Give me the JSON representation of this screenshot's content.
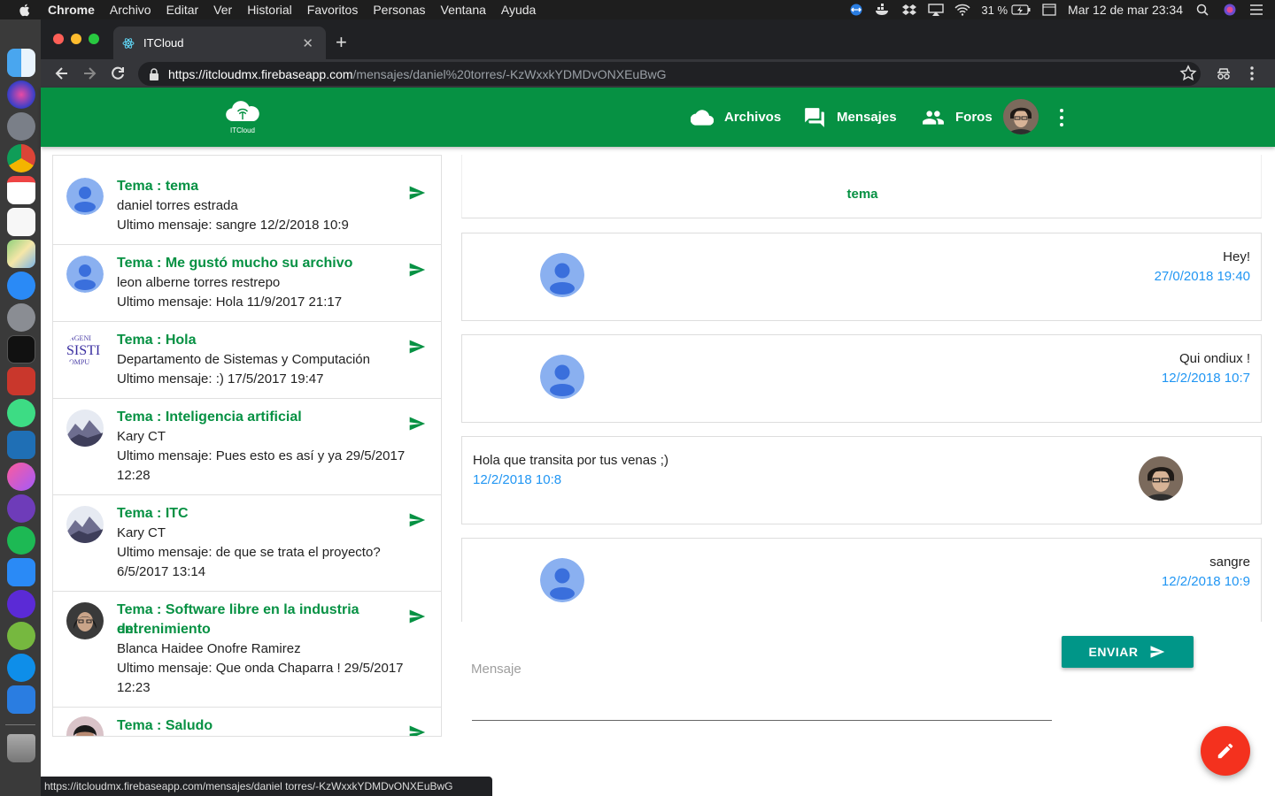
{
  "menubar": {
    "app_name": "Chrome",
    "items": [
      "Archivo",
      "Editar",
      "Ver",
      "Historial",
      "Favoritos",
      "Personas",
      "Ventana",
      "Ayuda"
    ],
    "battery": "31 %",
    "datetime": "Mar 12 de mar  23:34"
  },
  "browser": {
    "tab_title": "ITCloud",
    "url_host": "https://itcloudmx.firebaseapp.com",
    "url_path": "/mensajes/daniel%20torres/-KzWxxkYDMDvONXEuBwG",
    "status_url": "https://itcloudmx.firebaseapp.com/mensajes/daniel torres/-KzWxxkYDMDvONXEuBwG"
  },
  "header": {
    "logo_text": "ITCloud",
    "nav": [
      {
        "label": "Archivos",
        "icon": "cloud-icon"
      },
      {
        "label": "Mensajes",
        "icon": "forum-icon"
      },
      {
        "label": "Foros",
        "icon": "people-icon"
      }
    ]
  },
  "threads": [
    {
      "title": "Tema : tema",
      "author": "daniel torres estrada",
      "last": "Ultimo mensaje: sangre 12/2/2018 10:9",
      "last2": "",
      "avatar": "default"
    },
    {
      "title": "Tema : Me gustó mucho su archivo",
      "author": "leon alberne torres restrepo",
      "last": "Ultimo mensaje: Hola 11/9/2017 21:17",
      "last2": "",
      "avatar": "default"
    },
    {
      "title": "Tema : Hola",
      "author": "Departamento de Sistemas y Computación",
      "last": "Ultimo mensaje: :) 17/5/2017 19:47",
      "last2": "",
      "avatar": "logo"
    },
    {
      "title": "Tema : Inteligencia artificial",
      "author": "Kary CT",
      "last": "Ultimo mensaje: Pues esto es así y ya 29/5/2017",
      "last2": "12:28",
      "avatar": "landscape"
    },
    {
      "title": "Tema : ITC",
      "author": "Kary CT",
      "last": "Ultimo mensaje: de que se trata el proyecto?",
      "last2": "6/5/2017 13:14",
      "avatar": "landscape"
    },
    {
      "title": "Tema : Software libre en la industria del",
      "title2": "entrenimiento",
      "author": "Blanca Haidee Onofre Ramirez",
      "last": "Ultimo mensaje: Que onda Chaparra ! 29/5/2017",
      "last2": "12:23",
      "avatar": "photo"
    },
    {
      "title": "Tema : Saludo",
      "author": "",
      "last": "",
      "last2": "",
      "avatar": "photo2"
    }
  ],
  "chat": {
    "title": "tema",
    "messages": [
      {
        "text": "Hey!",
        "time": "27/0/2018 19:40",
        "side": "other"
      },
      {
        "text": "Qui ondiux !",
        "time": "12/2/2018 10:7",
        "side": "other"
      },
      {
        "text": "Hola que transita por tus venas ;)",
        "time": "12/2/2018 10:8",
        "side": "me"
      },
      {
        "text": "sangre",
        "time": "12/2/2018 10:9",
        "side": "other"
      }
    ]
  },
  "compose": {
    "placeholder": "Mensaje",
    "send_label": "ENVIAR"
  },
  "colors": {
    "brand_green": "#069143",
    "accent_teal": "#009688",
    "fab_red": "#f4311e",
    "time_blue": "#2196f3"
  }
}
